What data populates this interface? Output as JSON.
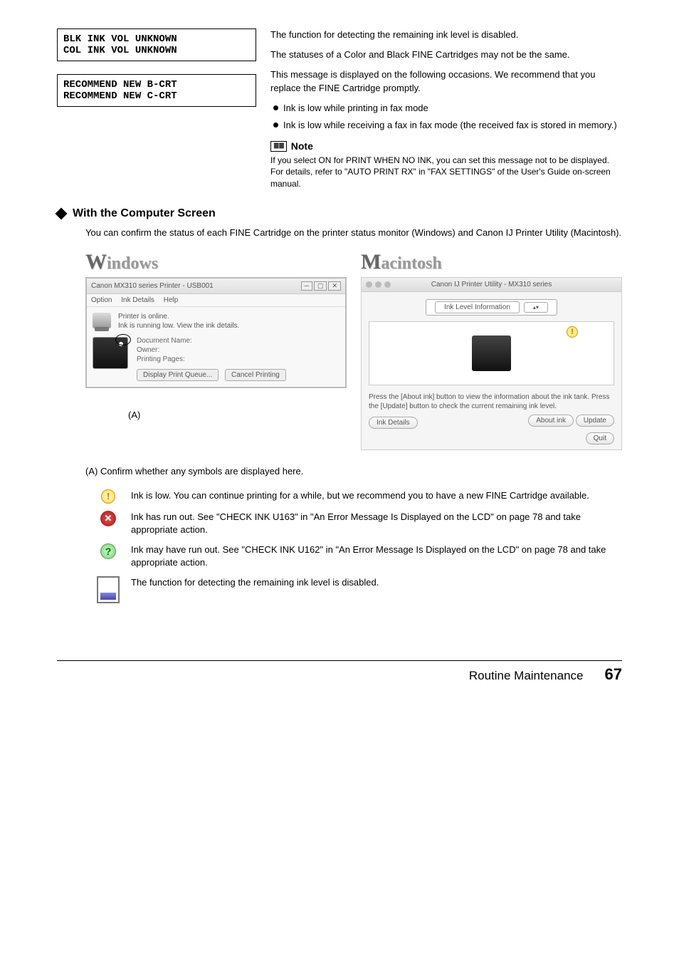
{
  "top": {
    "box1_line1": "BLK INK VOL UNKNOWN",
    "box1_line2": "COL INK VOL UNKNOWN",
    "box2_line1": "RECOMMEND NEW B-CRT",
    "box2_line2": "RECOMMEND NEW C-CRT",
    "para1": "The function for detecting the remaining ink level is disabled.",
    "para2": "The statuses of a Color and Black FINE Cartridges may not be the same.",
    "para3": "This message is displayed on the following occasions. We recommend that you replace the FINE Cartridge promptly.",
    "bullet1": "Ink is low while printing in fax mode",
    "bullet2": "Ink is low while receiving a fax in fax mode (the received fax is stored in memory.)",
    "note_label": "Note",
    "note_body": "If you select ON for PRINT WHEN NO INK, you can set this message not to be displayed. For details, refer to \"AUTO PRINT RX\" in \"FAX SETTINGS\" of the User's Guide on-screen manual."
  },
  "section2": {
    "heading": "With the Computer Screen",
    "intro": "You can confirm the status of each FINE Cartridge on the printer status monitor (Windows) and Canon IJ Printer Utility (Macintosh).",
    "windows_label": "Windows",
    "macintosh_label": "Macintosh",
    "win_panel_title": "Canon MX310 series Printer - USB001",
    "win_menu_option": "Option",
    "win_menu_ink": "Ink Details",
    "win_menu_help": "Help",
    "win_status1": "Printer is online.",
    "win_status2": "Ink is running low. View the ink details.",
    "win_doc": "Document Name:",
    "win_owner": "Owner:",
    "win_pages": "Printing Pages:",
    "win_btn_queue": "Display Print Queue...",
    "win_btn_cancel": "Cancel Printing",
    "a_label": "(A)",
    "mac_panel_title": "Canon IJ Printer Utility - MX310 series",
    "mac_select": "Ink Level Information",
    "mac_text1": "Press the [About ink] button to view the information about the ink tank. Press the [Update] button to check the current remaining ink level.",
    "mac_btn_details": "Ink Details",
    "mac_btn_about": "About ink",
    "mac_btn_update": "Update",
    "mac_btn_quit": "Quit",
    "confirm": "(A) Confirm whether any symbols are displayed here.",
    "icons": {
      "warn": "Ink is low. You can continue printing for a while, but we recommend you to have a new FINE Cartridge available.",
      "x": "Ink has run out. See \"CHECK INK U163\" in \"An Error Message Is Displayed on the LCD\" on page 78 and take appropriate action.",
      "q": "Ink may have run out. See \"CHECK INK U162\" in \"An Error Message Is Displayed on the LCD\" on page 78 and take appropriate action.",
      "box": "The function for detecting the remaining ink level is disabled."
    }
  },
  "footer": {
    "section": "Routine Maintenance",
    "page": "67"
  }
}
